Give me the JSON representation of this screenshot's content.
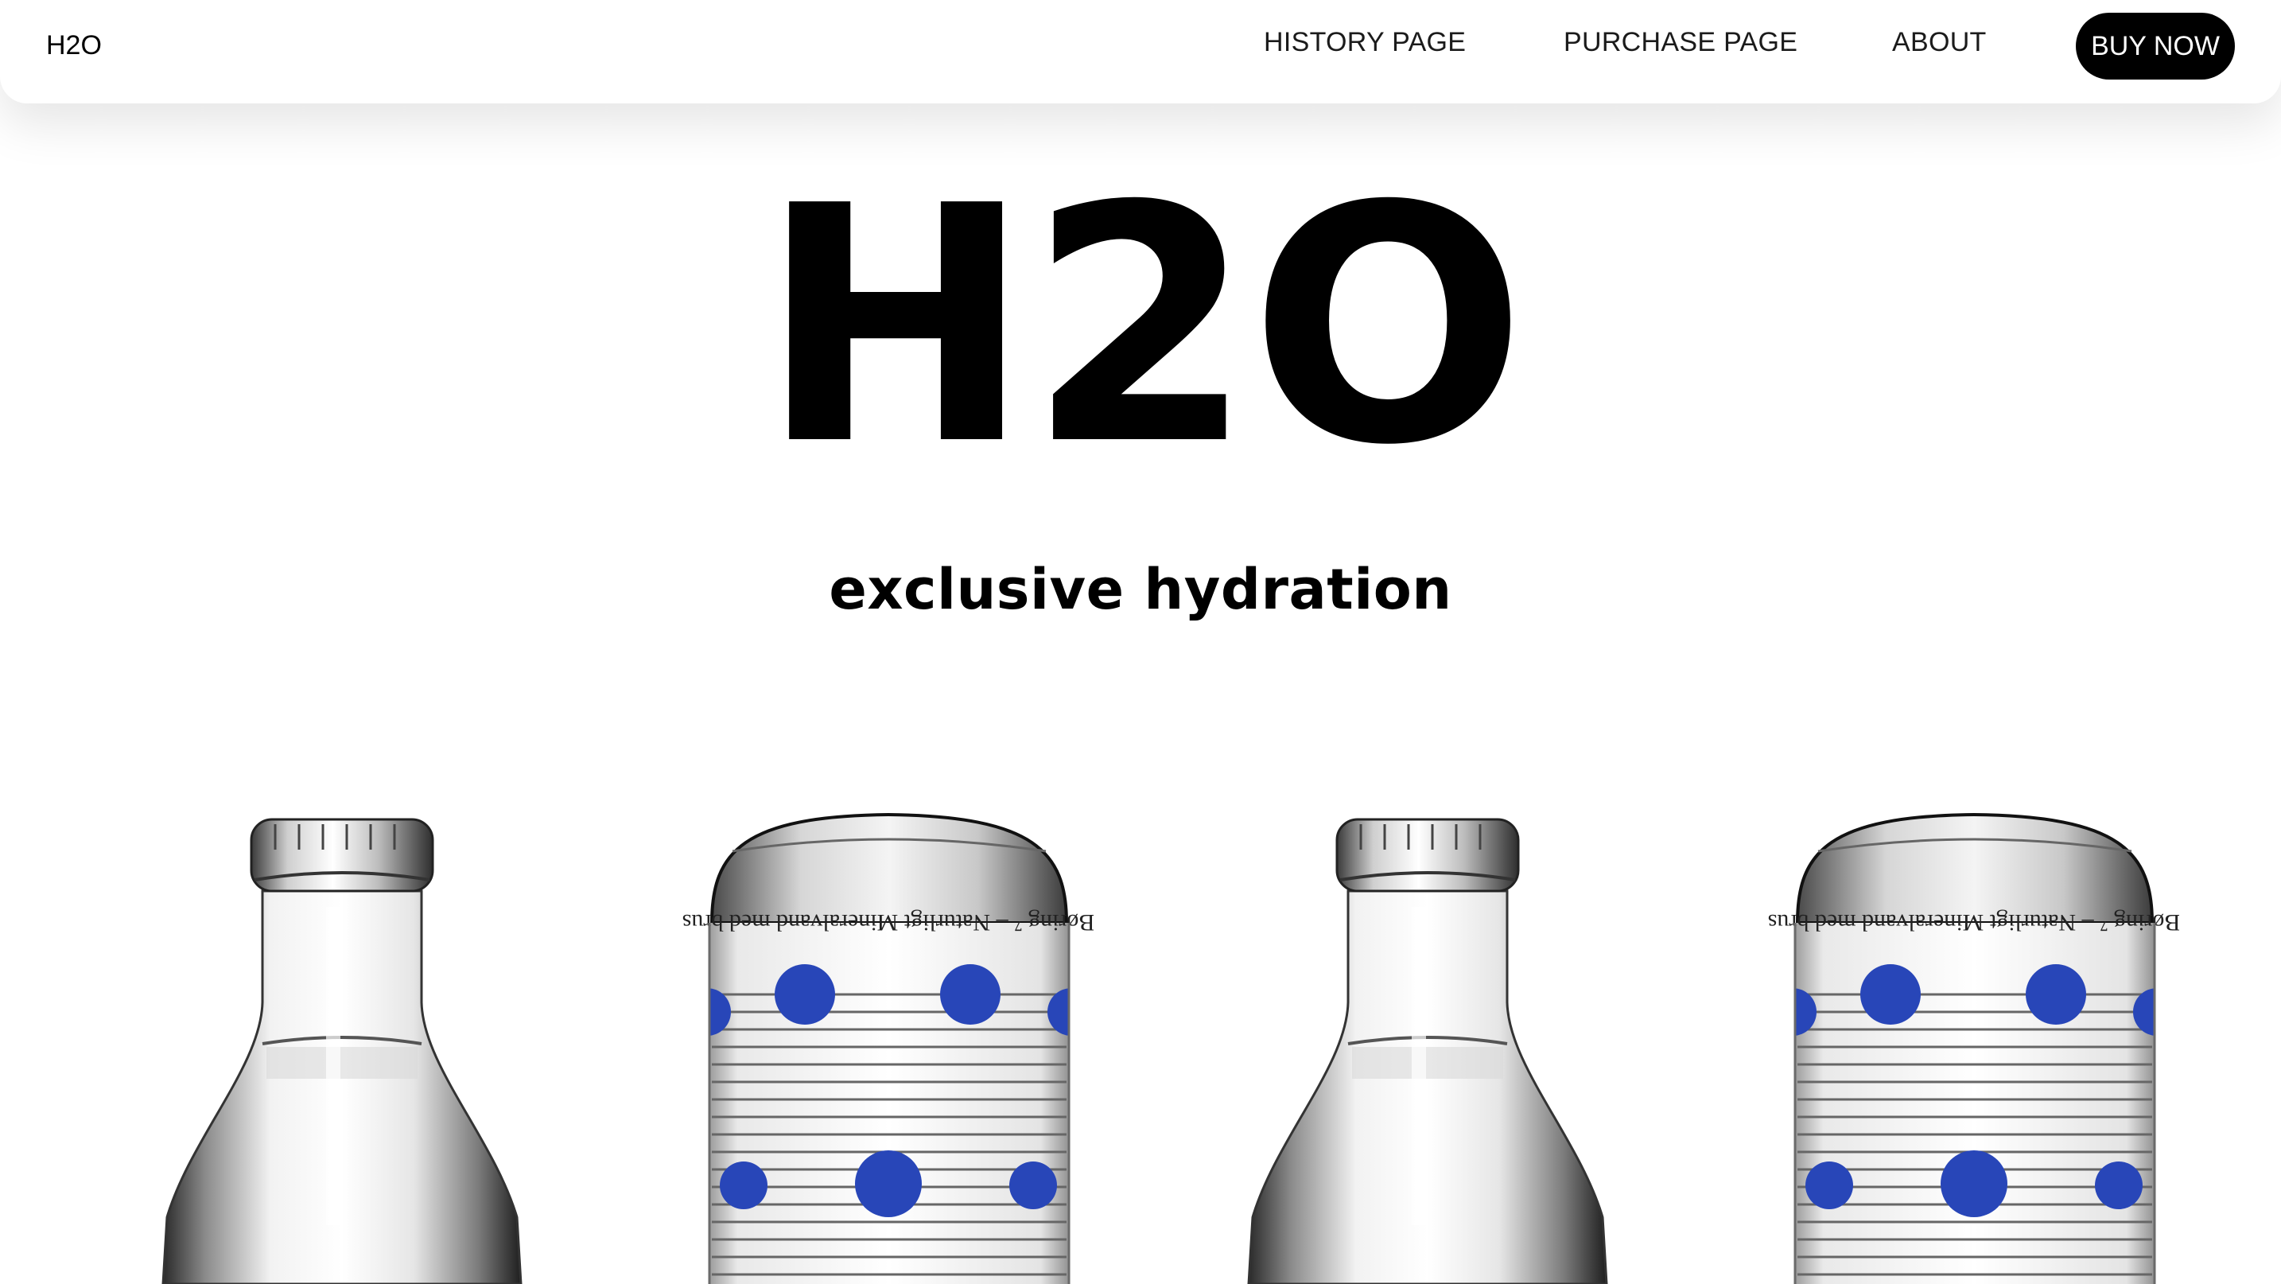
{
  "header": {
    "brand": "H2O",
    "nav": {
      "history": "HISTORY PAGE",
      "purchase": "PURCHASE PAGE",
      "about": "ABOUT"
    },
    "cta": "BUY NOW"
  },
  "hero": {
    "title": "H2O",
    "subtitle": "exclusive hydration"
  },
  "products": [
    {
      "kind": "glass-bottle"
    },
    {
      "kind": "can",
      "label_text": "Børing ⁷ – Naturligt Mineralvand med brus"
    },
    {
      "kind": "glass-bottle"
    },
    {
      "kind": "can",
      "label_text": "Børing ⁷ – Naturligt Mineralvand med brus"
    }
  ],
  "colors": {
    "accent": "#000000",
    "dot_blue": "#2846b8",
    "background": "#ffffff"
  }
}
